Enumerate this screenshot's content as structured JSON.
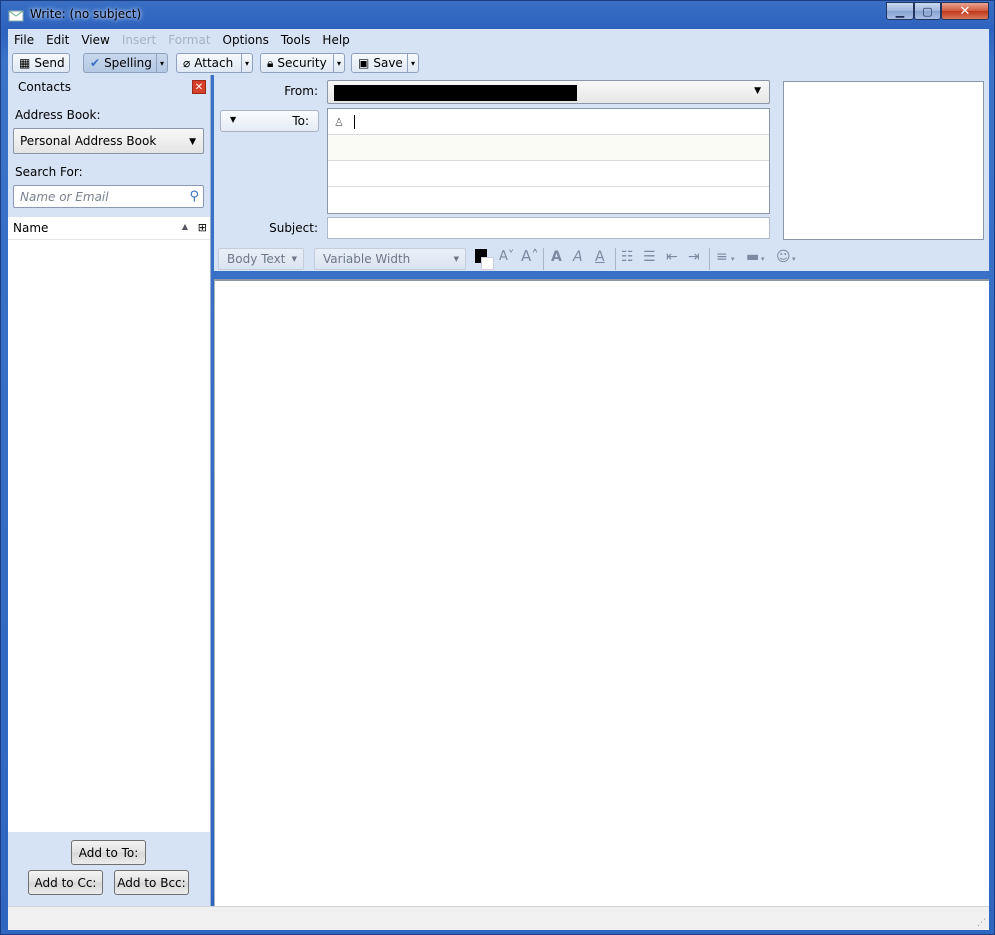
{
  "window": {
    "title": "Write: (no subject)"
  },
  "menu": [
    {
      "label": "File",
      "disabled": false
    },
    {
      "label": "Edit",
      "disabled": false
    },
    {
      "label": "View",
      "disabled": false
    },
    {
      "label": "Insert",
      "disabled": true
    },
    {
      "label": "Format",
      "disabled": true
    },
    {
      "label": "Options",
      "disabled": false
    },
    {
      "label": "Tools",
      "disabled": false
    },
    {
      "label": "Help",
      "disabled": false
    }
  ],
  "toolbar": {
    "send": "Send",
    "spelling": "Spelling",
    "attach": "Attach",
    "security": "Security",
    "save": "Save"
  },
  "contacts": {
    "title": "Contacts",
    "address_book_label": "Address Book:",
    "address_book_value": "Personal Address Book",
    "search_label": "Search For:",
    "search_placeholder": "Name or Email",
    "column_name": "Name",
    "add_to": "Add to To:",
    "add_cc": "Add to Cc:",
    "add_bcc": "Add to Bcc:"
  },
  "header": {
    "from_label": "From:",
    "to_label": "To:",
    "subject_label": "Subject:",
    "subject_value": ""
  },
  "format": {
    "paragraph": "Body Text",
    "font": "Variable Width"
  },
  "colors": {
    "window_frame": "#2f66c0",
    "chrome": "#d6e3f5",
    "redaction": "#000000"
  }
}
